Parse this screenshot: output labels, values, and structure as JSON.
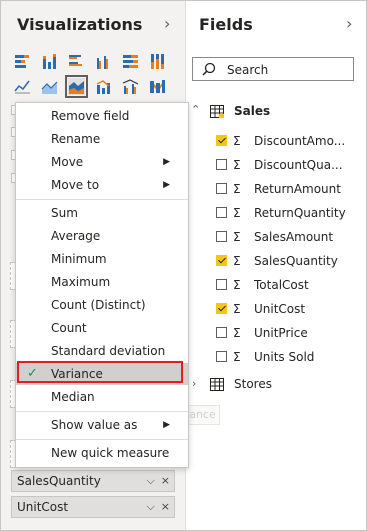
{
  "visualizations": {
    "title": "Visualizations",
    "collapse_glyph": "›",
    "fields": [
      {
        "label": "SalesQuantity"
      },
      {
        "label": "UnitCost"
      }
    ],
    "pill_icons": {
      "chevron": "⌵",
      "close": "×"
    }
  },
  "context_menu": {
    "groups": [
      [
        {
          "label": "Remove field"
        },
        {
          "label": "Rename"
        },
        {
          "label": "Move",
          "submenu": true
        },
        {
          "label": "Move to",
          "submenu": true
        }
      ],
      [
        {
          "label": "Sum"
        },
        {
          "label": "Average"
        },
        {
          "label": "Minimum"
        },
        {
          "label": "Maximum"
        },
        {
          "label": "Count (Distinct)"
        },
        {
          "label": "Count"
        },
        {
          "label": "Standard deviation"
        },
        {
          "label": "Variance",
          "selected": true
        },
        {
          "label": "Median"
        }
      ],
      [
        {
          "label": "Show value as",
          "submenu": true
        }
      ],
      [
        {
          "label": "New quick measure"
        }
      ]
    ],
    "ghost_drag_label": "Variance",
    "submenu_arrow": "▶",
    "check_glyph": "✓"
  },
  "fields_pane": {
    "title": "Fields",
    "collapse_glyph": "›",
    "search_placeholder": "Search",
    "tables": [
      {
        "name": "Sales",
        "expanded": true,
        "expand_glyph": "⌃",
        "fields": [
          {
            "name": "DiscountAmo...",
            "checked": true
          },
          {
            "name": "DiscountQua...",
            "checked": false
          },
          {
            "name": "ReturnAmount",
            "checked": false
          },
          {
            "name": "ReturnQuantity",
            "checked": false
          },
          {
            "name": "SalesAmount",
            "checked": false
          },
          {
            "name": "SalesQuantity",
            "checked": true
          },
          {
            "name": "TotalCost",
            "checked": false
          },
          {
            "name": "UnitCost",
            "checked": true
          },
          {
            "name": "UnitPrice",
            "checked": false
          },
          {
            "name": "Units Sold",
            "checked": false
          }
        ]
      },
      {
        "name": "Stores",
        "expanded": false,
        "expand_glyph": "›"
      }
    ],
    "sigma_glyph": "Σ"
  },
  "colors": {
    "accent_yellow": "#f2c811",
    "highlight_red": "#e21f26",
    "check_green": "#1e8e5a"
  }
}
